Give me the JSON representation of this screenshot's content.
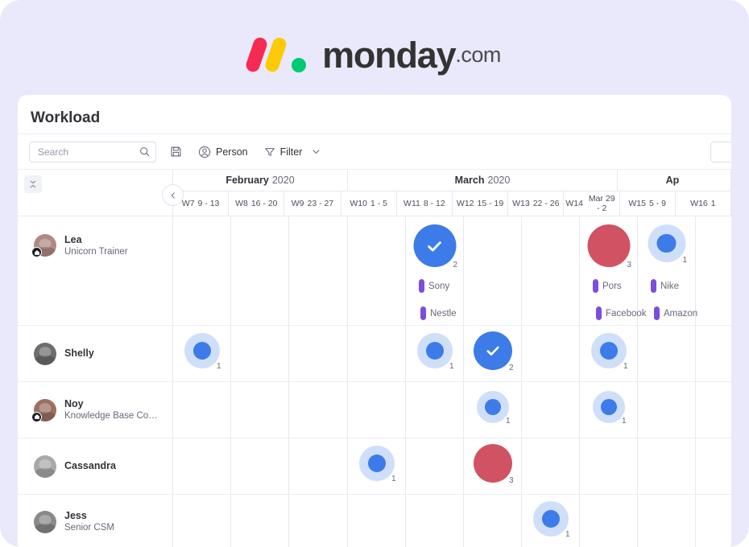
{
  "brand": {
    "name": "monday",
    "suffix": ".com",
    "colors": {
      "red": "#f62b54",
      "yellow": "#fdca07",
      "green": "#00ca72",
      "text": "#333333"
    }
  },
  "board": {
    "title": "Workload"
  },
  "toolbar": {
    "search": {
      "placeholder": "Search",
      "value": "",
      "icon": "search-icon"
    },
    "save_icon": "save-disk-icon",
    "person": {
      "label": "Person",
      "icon": "person-icon"
    },
    "filter": {
      "label": "Filter",
      "icon": "filter-funnel-icon",
      "chevron": "chevron-down-icon"
    }
  },
  "grid_header": {
    "collapse_icon": "collapse-vertical-icon",
    "back_icon": "chevron-left-icon",
    "months": [
      {
        "name": "February",
        "year": "2020",
        "span": 3
      },
      {
        "name": "March",
        "year": "2020",
        "span": 5
      },
      {
        "name": "Ap",
        "year": "",
        "span": 1
      }
    ],
    "weeks": [
      {
        "week": "W7",
        "range": "9 - 13"
      },
      {
        "week": "W8",
        "range": "16 - 20"
      },
      {
        "week": "W9",
        "range": "23 - 27"
      },
      {
        "week": "W10",
        "range": "1 - 5"
      },
      {
        "week": "W11",
        "range": "8 - 12"
      },
      {
        "week": "W12",
        "range": "15 - 19"
      },
      {
        "week": "W13",
        "range": "22 - 26"
      },
      {
        "week": "W14",
        "range": "Mar 29 - 2"
      },
      {
        "week": "W15",
        "range": "5 - 9"
      },
      {
        "week": "W16",
        "range": "1"
      }
    ]
  },
  "rows": [
    {
      "name": "Lea",
      "role": "Unicorn Trainer",
      "has_badge": true,
      "cells": [
        {},
        {},
        {},
        {},
        {
          "bubble": "check",
          "size": 53,
          "count": "2",
          "tags": [
            {
              "label": "Sony"
            },
            {
              "label": "Nestle"
            }
          ]
        },
        {},
        {},
        {
          "bubble": "red",
          "size": 53,
          "count": "3",
          "tags": [
            {
              "label": "Pors"
            },
            {
              "label": "Facebook"
            }
          ]
        },
        {
          "bubble": "donut",
          "size": 47,
          "count": "1",
          "tags": [
            {
              "label": "Nike"
            },
            {
              "label": "Amazon"
            }
          ]
        },
        {}
      ]
    },
    {
      "name": "Shelly",
      "role": "",
      "has_badge": false,
      "cells": [
        {
          "bubble": "donut",
          "size": 44,
          "count": "1"
        },
        {},
        {},
        {},
        {
          "bubble": "donut",
          "size": 44,
          "count": "1"
        },
        {
          "bubble": "check",
          "size": 48,
          "count": "2"
        },
        {},
        {
          "bubble": "donut",
          "size": 44,
          "count": "1"
        },
        {},
        {}
      ]
    },
    {
      "name": "Noy",
      "role": "Knowledge Base Cont...",
      "has_badge": true,
      "cells": [
        {},
        {},
        {},
        {},
        {},
        {
          "bubble": "donut",
          "size": 40,
          "count": "1"
        },
        {},
        {
          "bubble": "donut",
          "size": 40,
          "count": "1"
        },
        {},
        {}
      ]
    },
    {
      "name": "Cassandra",
      "role": "",
      "has_badge": false,
      "cells": [
        {},
        {},
        {},
        {
          "bubble": "donut",
          "size": 44,
          "count": "1"
        },
        {},
        {
          "bubble": "red",
          "size": 48,
          "count": "3"
        },
        {},
        {},
        {},
        {}
      ]
    },
    {
      "name": "Jess",
      "role": "Senior CSM",
      "has_badge": false,
      "cells": [
        {},
        {},
        {},
        {},
        {},
        {},
        {
          "bubble": "donut",
          "size": 44,
          "count": "1"
        },
        {},
        {},
        {}
      ]
    }
  ],
  "palette": {
    "blue": "#3d7be8",
    "light_blue": "#cfdffa",
    "red": "#d15262",
    "purple_pill": "#7b4ede",
    "background": "#e9e9fb"
  }
}
